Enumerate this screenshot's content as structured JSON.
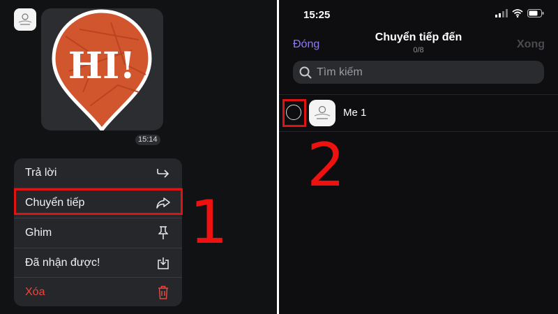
{
  "chat": {
    "message_time": "15:14",
    "sticker_text": "HI!",
    "menu": [
      {
        "label": "Trả lời",
        "icon": "reply-icon"
      },
      {
        "label": "Chuyển tiếp",
        "icon": "forward-icon"
      },
      {
        "label": "Ghim",
        "icon": "pin-icon"
      },
      {
        "label": "Đã nhận được!",
        "icon": "save-download-icon"
      },
      {
        "label": "Xóa",
        "icon": "trash-icon"
      }
    ]
  },
  "forward_screen": {
    "status_time": "15:25",
    "title": "Chuyển tiếp đến",
    "count": "0/8",
    "close_label": "Đóng",
    "done_label": "Xong",
    "search_placeholder": "Tìm kiếm",
    "contacts": [
      {
        "name": "Me 1"
      }
    ]
  },
  "steps": {
    "step1": "1",
    "step2": "2"
  },
  "colors": {
    "highlight": "#e11212",
    "accent": "#8b7cf3",
    "danger": "#e8483f",
    "sticker": "#d2562d"
  }
}
